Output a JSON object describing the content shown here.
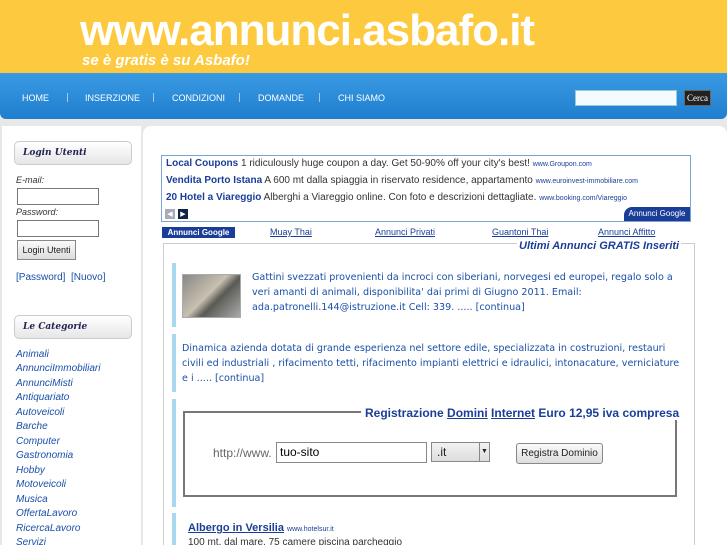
{
  "header": {
    "title": "www.annunci.asbafo.it",
    "slogan": "se è gratis è su Asbafo!"
  },
  "nav": [
    "HOME",
    "INSERZIONE",
    "CONDIZIONI",
    "DOMANDE",
    "CHI SIAMO"
  ],
  "search": {
    "button": "Cerca",
    "value": ""
  },
  "login": {
    "title": "Login Utenti",
    "email_label": "E-mail:",
    "password_label": "Password:",
    "button": "Login Utenti",
    "password_link": "[Password]",
    "new_link": "[Nuovo]"
  },
  "categories": {
    "title": "Le Categorie",
    "items": [
      "Animali",
      "AnnunciImmobiliari",
      "AnnunciMisti",
      "Antiquariato",
      "Autoveicoli",
      "Barche",
      "Computer",
      "Gastronomia",
      "Hobby",
      "Motoveicoli",
      "Musica",
      "OffertaLavoro",
      "RicercaLavoro",
      "Servizi"
    ]
  },
  "ads": [
    {
      "title": "Local Coupons",
      "text": " 1 ridiculously huge coupon a day. Get 50-90% off your city's best!",
      "url": "www.Groupon.com"
    },
    {
      "title": "Vendita Porto Istana",
      "text": " A 600 mt dalla spiaggia in riservato residence, appartamento",
      "url": "www.euroinvest-immobiliare.com"
    },
    {
      "title": "20 Hotel a Viareggio",
      "text": " Alberghi a Viareggio online. Con foto e descrizioni dettagliate.",
      "url": "www.booking.com/Viareggio"
    }
  ],
  "ads_by": "Annunci Google",
  "ad_links": [
    "Annunci Google",
    "Muay Thai",
    "Annunci Privati",
    "Guantoni Thai",
    "Annunci Affitto"
  ],
  "listings": {
    "title": "Ultimi Annunci GRATIS Inseriti",
    "items": [
      {
        "text": "Gattini svezzati provenienti da incroci con siberiani, norvegesi ed europei, regalo solo a veri amanti di animali, disponibilita' dai primi di Giugno 2011. Email: ada.patronelli.144@istruzione.it Cell: 339. ..... [continua]"
      },
      {
        "text": "Dinamica azienda dotata di grande esperienza nel settore edile, specializzata in costruzioni, restauri civili ed industriali , rifacimento tetti, rifacimento impianti elettrici e idraulici, intonacature, verniciature e i ..... [continua]"
      }
    ]
  },
  "domain_reg": {
    "title_pre": "Registrazione ",
    "title_link1": "Domini",
    "title_link2": "Internet",
    "title_post": " Euro 12,95 iva compresa",
    "prefix": "http://www.",
    "input_value": "tuo-sito",
    "tld": ".it",
    "button": "Registra Dominio"
  },
  "bottom_ad": {
    "title": "Albergo in Versilia",
    "url": "www.hotelsur.it",
    "desc": "100 mt. dal mare, 75 camere piscina parcheggio"
  }
}
